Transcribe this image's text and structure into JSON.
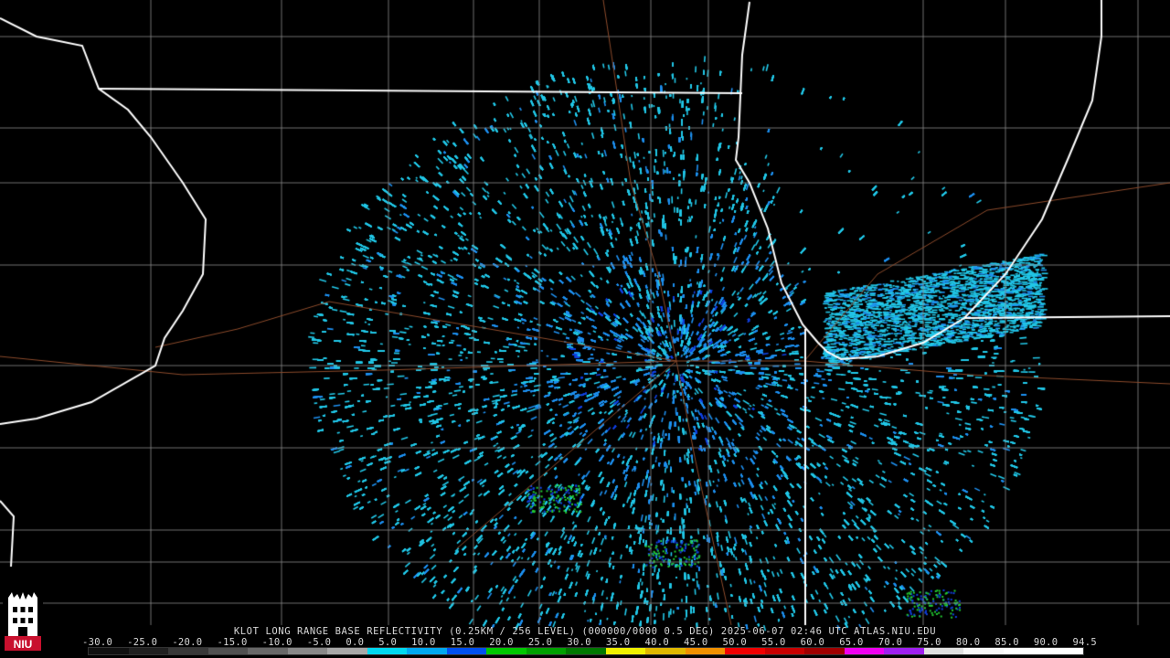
{
  "caption": "KLOT LONG RANGE BASE REFLECTIVITY (0.25KM / 256 LEVEL) (000000/0000 0.5 DEG) 2025-06-07 02:46 UTC  ATLAS.NIU.EDU",
  "legend": {
    "labels": [
      "-30.0",
      "-25.0",
      "-20.0",
      "-15.0",
      "-10.0",
      "-5.0",
      "0.0",
      "5.0",
      "10.0",
      "15.0",
      "20.0",
      "25.0",
      "30.0",
      "35.0",
      "40.0",
      "45.0",
      "50.0",
      "55.0",
      "60.0",
      "65.0",
      "70.0",
      "75.0",
      "80.0",
      "85.0",
      "90.0",
      "94.5"
    ],
    "colors": [
      "#101010",
      "#202020",
      "#383838",
      "#505050",
      "#686868",
      "#888888",
      "#a8a8a8",
      "#00d8f0",
      "#00a8f0",
      "#0050f0",
      "#00c800",
      "#00a000",
      "#007800",
      "#f0f000",
      "#e0b800",
      "#f09000",
      "#f00000",
      "#c80000",
      "#a00000",
      "#f000f0",
      "#a020f0",
      "#e0e0e0",
      "#f8f8f8",
      "#ffffff",
      "#ffffff"
    ]
  },
  "logo": {
    "text": "NIU"
  },
  "colors": {
    "background": "#000000",
    "state_border": "#ffffff",
    "county_border": "#8a8a8a",
    "highway": "#8b4a2b",
    "echo_light": "#22c8e8",
    "echo_medium": "#1e90f0",
    "echo_dark": "#1040e0",
    "echo_green": "#22cc33"
  }
}
